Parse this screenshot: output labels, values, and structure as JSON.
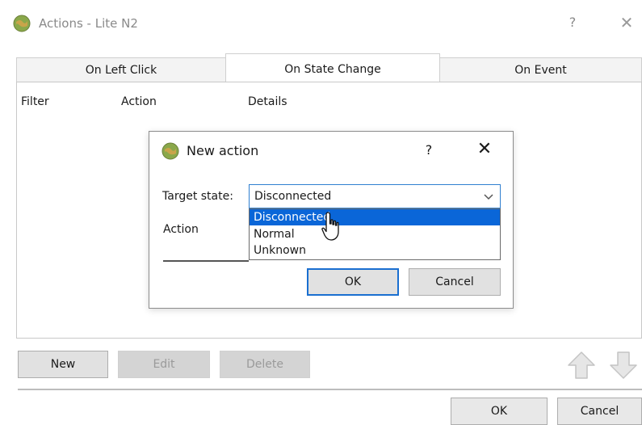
{
  "window": {
    "title": "Actions - Lite N2",
    "help": "?",
    "close": "✕"
  },
  "tabs": [
    {
      "label": "On Left Click"
    },
    {
      "label": "On State Change"
    },
    {
      "label": "On Event"
    }
  ],
  "table": {
    "columns": [
      "Filter",
      "Action",
      "Details"
    ]
  },
  "buttons": {
    "new": "New",
    "edit": "Edit",
    "delete": "Delete",
    "ok": "OK",
    "cancel": "Cancel"
  },
  "icons": {
    "app": "app-globe-icon",
    "up": "arrow-up-icon",
    "down": "arrow-down-icon"
  },
  "dialog": {
    "title": "New action",
    "help": "?",
    "close": "✕",
    "target_state_label": "Target state:",
    "target_state_value": "Disconnected",
    "action_label": "Action",
    "options": [
      "Disconnected",
      "Normal",
      "Unknown"
    ],
    "ok": "OK",
    "cancel": "Cancel"
  },
  "colors": {
    "selection": "#0a66d8",
    "focus_border": "#2f7fd0"
  }
}
